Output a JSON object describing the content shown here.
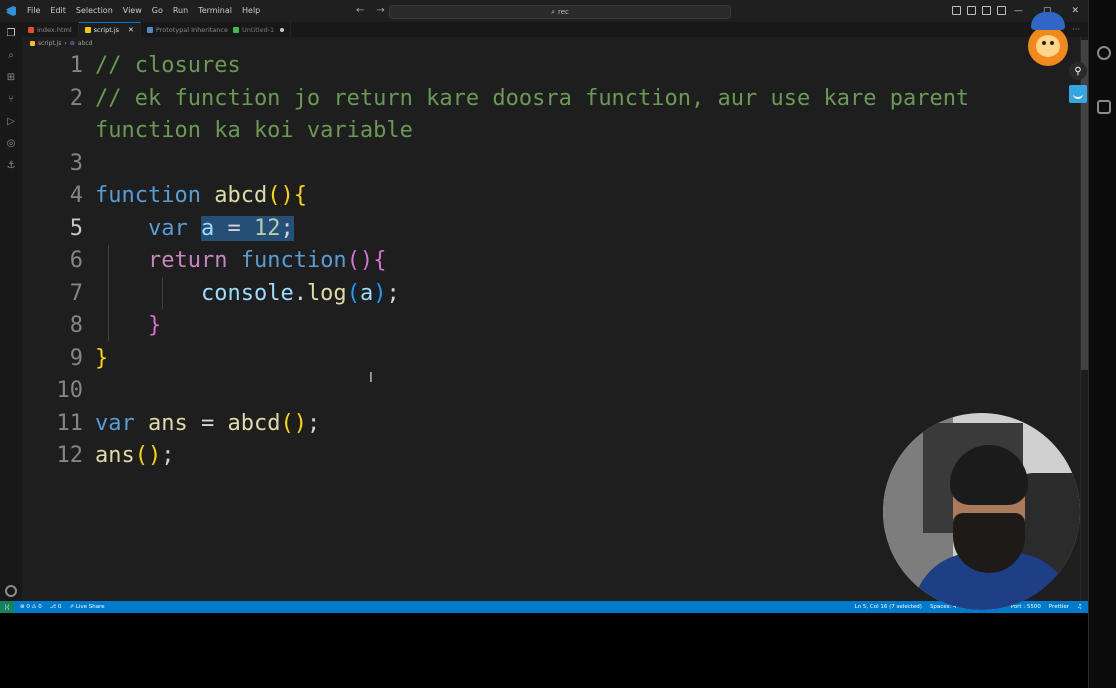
{
  "menu": [
    "File",
    "Edit",
    "Selection",
    "View",
    "Go",
    "Run",
    "Terminal",
    "Help"
  ],
  "search": {
    "text": "rec",
    "icon": "search-icon"
  },
  "window_controls": [
    "—",
    "▢",
    "✕"
  ],
  "tabs": [
    {
      "label": "index.html",
      "icon_color": "#e44d26",
      "active": false
    },
    {
      "label": "script.js",
      "icon_color": "#f1c40f",
      "active": true
    },
    {
      "label": "Prototypal Inheritance",
      "icon_color": "#4e88c8",
      "active": false,
      "badge": "Untitled-1"
    }
  ],
  "breadcrumb": {
    "file": "script.js",
    "symbol": "abcd"
  },
  "code": {
    "line_numbers": [
      "1",
      "2",
      "",
      "3",
      "4",
      "5",
      "6",
      "7",
      "8",
      "9",
      "10",
      "11",
      "12"
    ],
    "current_line": "5"
  },
  "status": {
    "errors": "0",
    "warnings": "0",
    "ports": "0",
    "live_share": "Live Share",
    "position": "Ln 5, Col 16 (7 selected)",
    "spaces": "Spaces: 4",
    "encoding": "UTF-8",
    "eol": "CRLF",
    "port": "Port : 5500",
    "formatter": "Prettier"
  },
  "colors": {
    "statusbar": "#007acc",
    "comment": "#6a9955",
    "keyword": "#569cd6",
    "function": "#dcdcaa",
    "variable": "#9cdcfe",
    "number": "#b5cea8",
    "selection": "#264f78"
  }
}
